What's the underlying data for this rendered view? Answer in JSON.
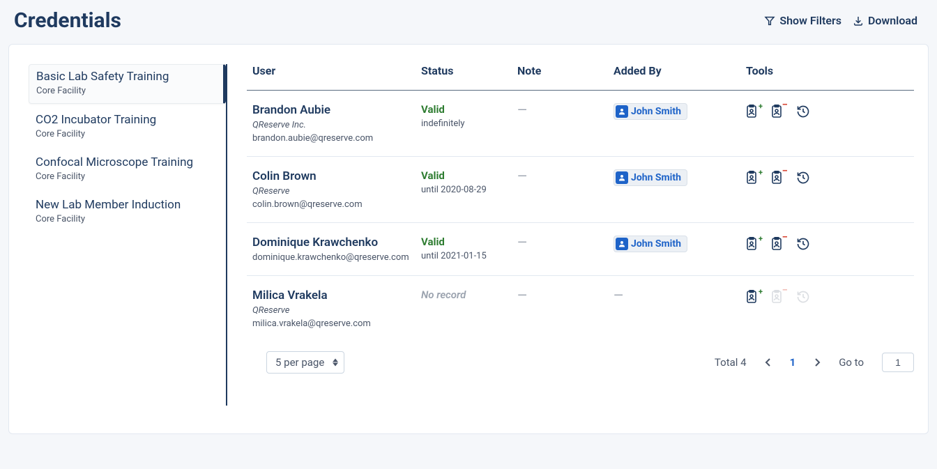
{
  "header": {
    "title": "Credentials",
    "show_filters": "Show Filters",
    "download": "Download"
  },
  "sidebar": {
    "items": [
      {
        "title": "Basic Lab Safety Training",
        "sub": "Core Facility",
        "active": true
      },
      {
        "title": "CO2 Incubator Training",
        "sub": "Core Facility",
        "active": false
      },
      {
        "title": "Confocal Microscope Training",
        "sub": "Core Facility",
        "active": false
      },
      {
        "title": "New Lab Member Induction",
        "sub": "Core Facility",
        "active": false
      }
    ]
  },
  "table": {
    "headers": {
      "user": "User",
      "status": "Status",
      "note": "Note",
      "added_by": "Added By",
      "tools": "Tools"
    },
    "rows": [
      {
        "name": "Brandon Aubie",
        "org": "QReserve Inc.",
        "email": "brandon.aubie@qreserve.com",
        "status": "Valid",
        "status_type": "valid",
        "status_sub": "indefinitely",
        "note": "—",
        "added_by": "John Smith",
        "has_record": true
      },
      {
        "name": "Colin Brown",
        "org": "QReserve",
        "email": "colin.brown@qreserve.com",
        "status": "Valid",
        "status_type": "valid",
        "status_sub": "until 2020-08-29",
        "note": "—",
        "added_by": "John Smith",
        "has_record": true
      },
      {
        "name": "Dominique Krawchenko",
        "org": "",
        "email": "dominique.krawchenko@qreserve.com",
        "status": "Valid",
        "status_type": "valid",
        "status_sub": "until 2021-01-15",
        "note": "—",
        "added_by": "John Smith",
        "has_record": true
      },
      {
        "name": "Milica Vrakela",
        "org": "QReserve",
        "email": "milica.vrakela@qreserve.com",
        "status": "No record",
        "status_type": "norecord",
        "status_sub": "",
        "note": "—",
        "added_by": "—",
        "has_record": false
      }
    ]
  },
  "pagination": {
    "per_page": "5 per page",
    "total_label": "Total 4",
    "current_page": "1",
    "goto_label": "Go to",
    "goto_value": "1"
  }
}
